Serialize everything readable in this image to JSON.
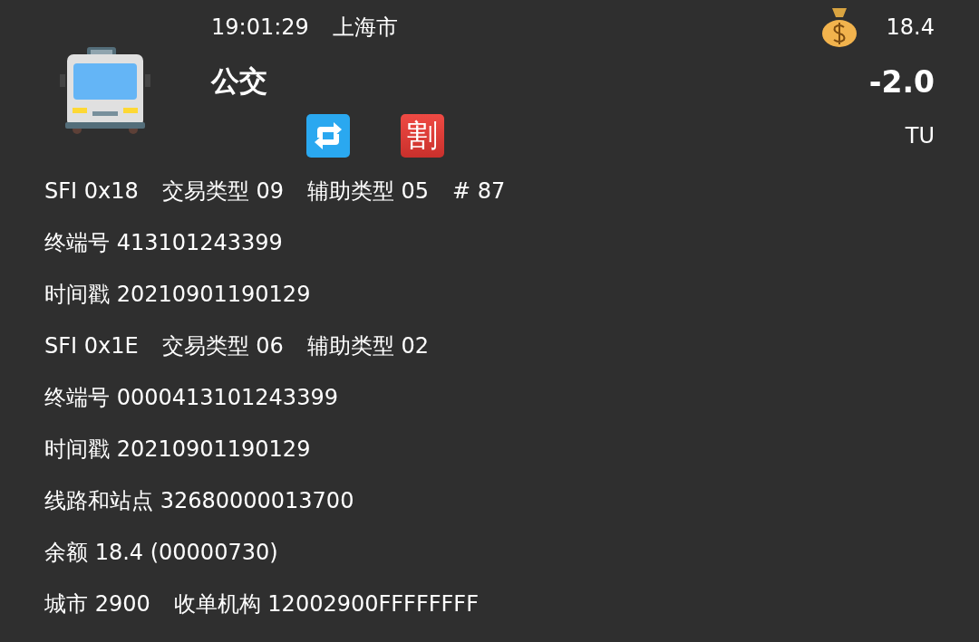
{
  "header": {
    "time": "19:01:29",
    "city": "上海市",
    "title": "公交",
    "badges": [
      {
        "kind": "repeat"
      },
      {
        "kind": "discount",
        "text": "割"
      }
    ],
    "balance": "18.4",
    "amount": "-2.0",
    "unit": "TU"
  },
  "lines": [
    [
      "SFI 0x18",
      "交易类型 09",
      "辅助类型 05",
      "# 87"
    ],
    [
      "终端号 413101243399"
    ],
    [
      "时间戳 20210901190129"
    ],
    [
      "SFI 0x1E",
      "交易类型 06",
      "辅助类型 02"
    ],
    [
      "终端号 0000413101243399"
    ],
    [
      "时间戳 20210901190129"
    ],
    [
      "线路和站点 32680000013700"
    ],
    [
      "余额 18.4 (00000730)"
    ],
    [
      "城市 2900",
      "收单机构 12002900FFFFFFFF"
    ]
  ]
}
